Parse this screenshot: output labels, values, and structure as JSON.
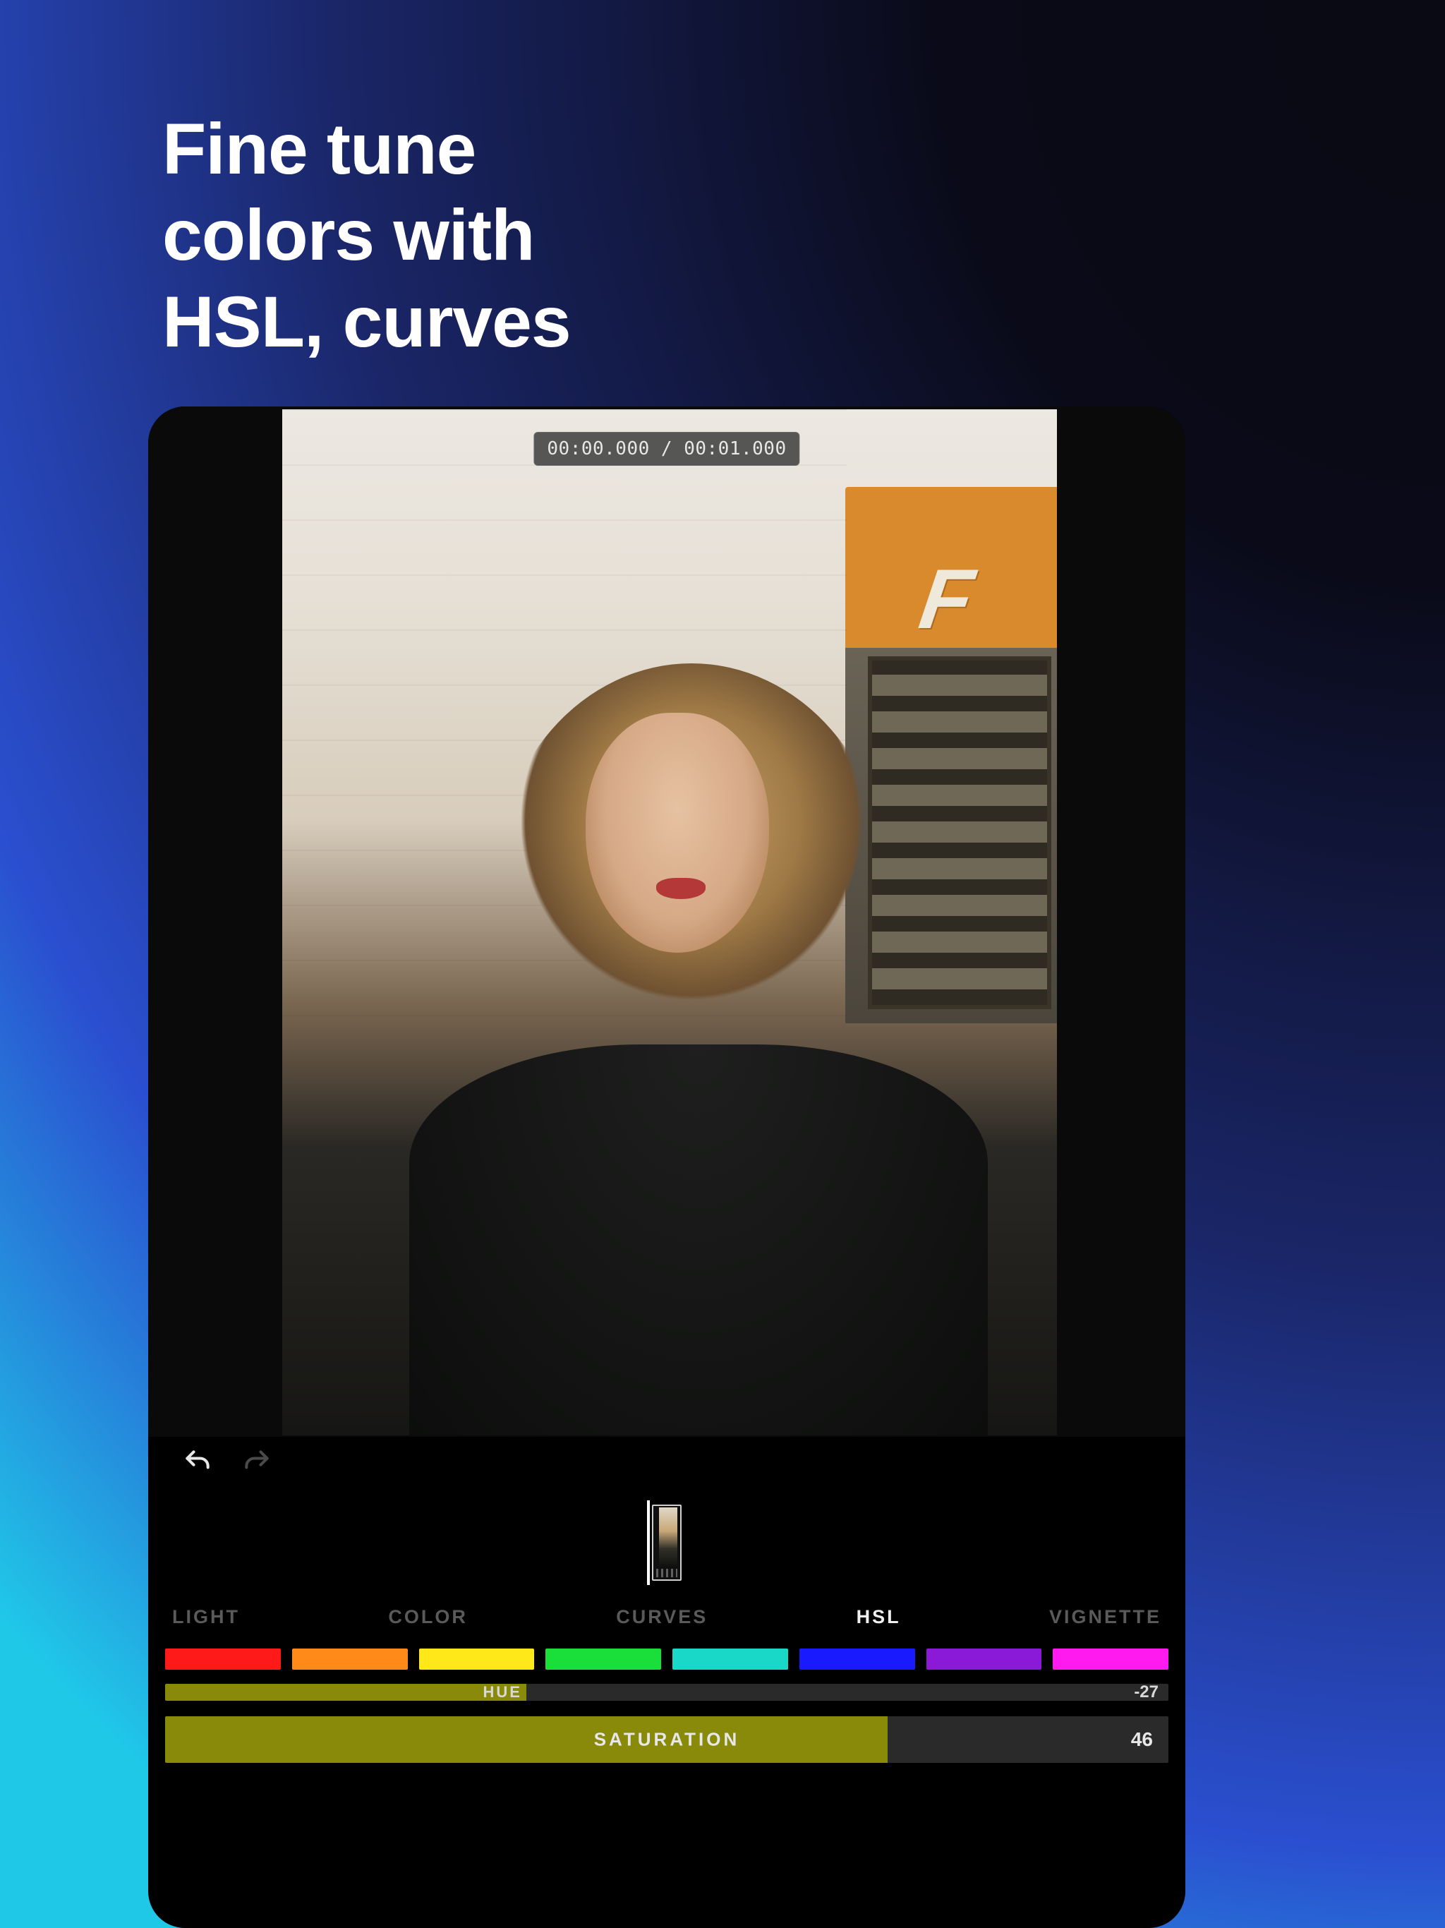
{
  "headline": {
    "line1": "Fine tune",
    "line2": "colors with",
    "line3": "HSL, curves"
  },
  "editor": {
    "timecode": "00:00.000 / 00:01.000",
    "truck_letter": "F",
    "tabs": [
      {
        "label": "LIGHT",
        "active": false
      },
      {
        "label": "COLOR",
        "active": false
      },
      {
        "label": "CURVES",
        "active": false
      },
      {
        "label": "HSL",
        "active": true
      },
      {
        "label": "VIGNETTE",
        "active": false
      }
    ],
    "swatches": [
      "#ff1a1a",
      "#ff8a1a",
      "#ffe81a",
      "#1adf3a",
      "#1ad8c8",
      "#1a1aff",
      "#8a1ad8",
      "#ff1af0"
    ],
    "sliders": {
      "hue": {
        "label": "HUE",
        "value": -27,
        "fill_pct": 36,
        "fill_color": "#8a8a0a",
        "label_visible_fragment": "HUE"
      },
      "saturation": {
        "label": "SATURATION",
        "value": 46,
        "fill_pct": 72,
        "fill_color": "#8a8a0a"
      }
    }
  }
}
